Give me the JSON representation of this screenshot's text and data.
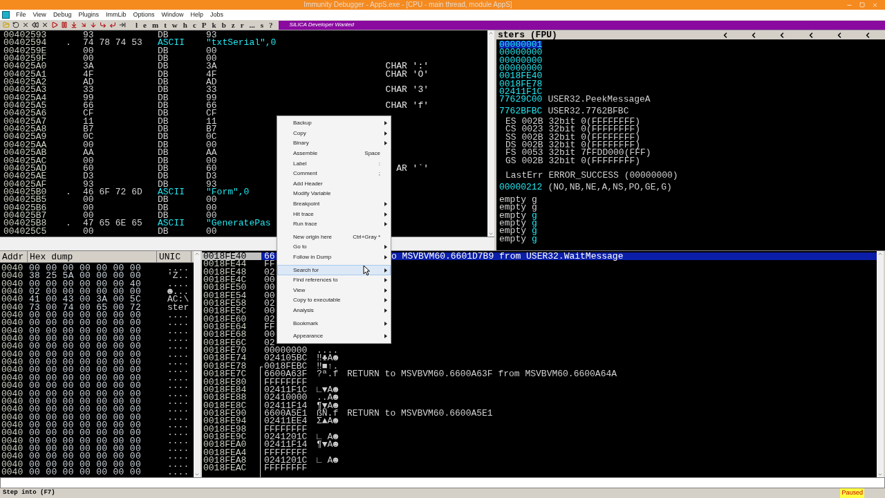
{
  "window": {
    "title": "Immunity Debugger - AppS.exe - [CPU - main thread, module AppS]"
  },
  "menu_bar": [
    "File",
    "View",
    "Debug",
    "Plugins",
    "ImmLib",
    "Options",
    "Window",
    "Help",
    "Jobs"
  ],
  "toolbar": {
    "letters": [
      "l",
      "e",
      "m",
      "t",
      "w",
      "h",
      "c",
      "P",
      "k",
      "b",
      "z",
      "r",
      "...",
      "s",
      "?"
    ],
    "banner": "SILICA Developer Wanted"
  },
  "disassembly": [
    {
      "kind": "db",
      "address": "00402593",
      "hex": "93",
      "mnemonic": "DB",
      "operand": "93"
    },
    {
      "kind": "ascii",
      "address": "00402594",
      "dot": ".",
      "hex": "74 78 74 53",
      "mnemonic": "ASCII",
      "operand": "\"txtSerial\",0"
    },
    {
      "kind": "db",
      "address": "0040259E",
      "hex": "00",
      "mnemonic": "DB",
      "operand": "00"
    },
    {
      "kind": "db",
      "address": "0040259F",
      "hex": "00",
      "mnemonic": "DB",
      "operand": "00"
    },
    {
      "kind": "db",
      "address": "004025A0",
      "hex": "3A",
      "mnemonic": "DB",
      "operand": "3A",
      "comment": "CHAR ':'"
    },
    {
      "kind": "db",
      "address": "004025A1",
      "hex": "4F",
      "mnemonic": "DB",
      "operand": "4F",
      "comment": "CHAR 'O'"
    },
    {
      "kind": "db",
      "address": "004025A2",
      "hex": "AD",
      "mnemonic": "DB",
      "operand": "AD"
    },
    {
      "kind": "db",
      "address": "004025A3",
      "hex": "33",
      "mnemonic": "DB",
      "operand": "33",
      "comment": "CHAR '3'"
    },
    {
      "kind": "db",
      "address": "004025A4",
      "hex": "99",
      "mnemonic": "DB",
      "operand": "99"
    },
    {
      "kind": "db",
      "address": "004025A5",
      "hex": "66",
      "mnemonic": "DB",
      "operand": "66",
      "comment": "CHAR 'f'"
    },
    {
      "kind": "db",
      "address": "004025A6",
      "hex": "CF",
      "mnemonic": "DB",
      "operand": "CF"
    },
    {
      "kind": "db",
      "address": "004025A7",
      "hex": "11",
      "mnemonic": "DB",
      "operand": "11"
    },
    {
      "kind": "db",
      "address": "004025A8",
      "hex": "B7",
      "mnemonic": "DB",
      "operand": "B7"
    },
    {
      "kind": "db",
      "address": "004025A9",
      "hex": "0C",
      "mnemonic": "DB",
      "operand": "0C"
    },
    {
      "kind": "db",
      "address": "004025AA",
      "hex": "00",
      "mnemonic": "DB",
      "operand": "00"
    },
    {
      "kind": "db",
      "address": "004025AB",
      "hex": "AA",
      "mnemonic": "DB",
      "operand": "AA"
    },
    {
      "kind": "db",
      "address": "004025AC",
      "hex": "00",
      "mnemonic": "DB",
      "operand": "00"
    },
    {
      "kind": "db",
      "address": "004025AD",
      "hex": "60",
      "mnemonic": "DB",
      "operand": "60",
      "comment": "AR '`'"
    },
    {
      "kind": "db",
      "address": "004025AE",
      "hex": "D3",
      "mnemonic": "DB",
      "operand": "D3"
    },
    {
      "kind": "db",
      "address": "004025AF",
      "hex": "93",
      "mnemonic": "DB",
      "operand": "93"
    },
    {
      "kind": "ascii",
      "address": "004025B0",
      "dot": ".",
      "hex": "46 6F 72 6D",
      "mnemonic": "ASCII",
      "operand": "\"Form\",0"
    },
    {
      "kind": "db",
      "address": "004025B5",
      "hex": "00",
      "mnemonic": "DB",
      "operand": "00"
    },
    {
      "kind": "db",
      "address": "004025B6",
      "hex": "00",
      "mnemonic": "DB",
      "operand": "00"
    },
    {
      "kind": "db",
      "address": "004025B7",
      "hex": "00",
      "mnemonic": "DB",
      "operand": "00"
    },
    {
      "kind": "ascii",
      "address": "004025B8",
      "dot": ".",
      "hex": "47 65 6E 65",
      "mnemonic": "ASCII",
      "operand": "\"GeneratePas"
    },
    {
      "kind": "db",
      "address": "004025C5",
      "hex": "00",
      "mnemonic": "DB",
      "operand": "00"
    }
  ],
  "registers": {
    "header": "sters (FPU)",
    "general": [
      {
        "value": "00000001",
        "selected": true
      },
      {
        "value": "00000000",
        "selected": false
      },
      {
        "value": "00000000",
        "selected": false
      },
      {
        "value": "00000000",
        "selected": false
      },
      {
        "value": "0018FE40",
        "selected": false
      },
      {
        "value": "0018FE78",
        "selected": false
      },
      {
        "value": "02411F1C",
        "selected": false
      },
      {
        "value": "77629C00",
        "comment": "USER32.PeekMessageA",
        "selected": false
      }
    ],
    "eip": {
      "value": "7762BFBC",
      "comment": "USER32.7762BFBC"
    },
    "segments": [
      "ES 002B 32bit 0(FFFFFFFF)",
      "CS 0023 32bit 0(FFFFFFFF)",
      "SS 002B 32bit 0(FFFFFFFF)",
      "DS 002B 32bit 0(FFFFFFFF)",
      "FS 0053 32bit 7FFDD000(FFF)",
      "GS 002B 32bit 0(FFFFFFFF)"
    ],
    "last_error": "LastErr ERROR_SUCCESS (00000000)",
    "flags": {
      "value": "00000212",
      "text": "(NO,NB,NE,A,NS,PO,GE,G)"
    },
    "fpu": [
      {
        "label": "empty",
        "tag": "g",
        "highlighted": false
      },
      {
        "label": "empty",
        "tag": "g",
        "highlighted": false
      },
      {
        "label": "empty",
        "tag": "g",
        "highlighted": true
      },
      {
        "label": "empty",
        "tag": "g",
        "highlighted": true
      },
      {
        "label": "empty",
        "tag": "g",
        "highlighted": true
      },
      {
        "label": "empty",
        "tag": "g",
        "highlighted": true
      }
    ]
  },
  "hex_dump": {
    "columns": [
      "Addr",
      "Hex dump",
      "UNIC"
    ],
    "rows": [
      {
        "address": "0040",
        "hex": "00 00 00 00 00 00 00",
        "text": "...."
      },
      {
        "address": "0040",
        "hex": "38 25 5A 00 00 00 00",
        "text": "'Z.."
      },
      {
        "address": "0040",
        "hex": "00 00 00 00 00 00 40",
        "text": "...."
      },
      {
        "address": "0040",
        "hex": "02 00 00 00 00 00 00",
        "text": "☻..."
      },
      {
        "address": "0040",
        "hex": "41 00 43 00 3A 00 5C",
        "text": "AC:\\"
      },
      {
        "address": "0040",
        "hex": "73 00 74 00 65 00 72",
        "text": "ster"
      },
      {
        "address": "0040",
        "hex": "00 00 00 00 00 00 00",
        "text": "...."
      },
      {
        "address": "0040",
        "hex": "00 00 00 00 00 00 00",
        "text": "...."
      },
      {
        "address": "0040",
        "hex": "00 00 00 00 00 00 00",
        "text": "...."
      },
      {
        "address": "0040",
        "hex": "00 00 00 00 00 00 00",
        "text": "...."
      },
      {
        "address": "0040",
        "hex": "00 00 00 00 00 00 00",
        "text": "...."
      },
      {
        "address": "0040",
        "hex": "00 00 00 00 00 00 00",
        "text": "...."
      },
      {
        "address": "0040",
        "hex": "00 00 00 00 00 00 00",
        "text": "...."
      },
      {
        "address": "0040",
        "hex": "00 00 00 00 00 00 00",
        "text": "...."
      },
      {
        "address": "0040",
        "hex": "00 00 00 00 00 00 00",
        "text": "...."
      },
      {
        "address": "0040",
        "hex": "00 00 00 00 00 00 00",
        "text": "...."
      },
      {
        "address": "0040",
        "hex": "00 00 00 00 00 00 00",
        "text": "...."
      },
      {
        "address": "0040",
        "hex": "00 00 00 00 00 00 00",
        "text": "...."
      },
      {
        "address": "0040",
        "hex": "00 00 00 00 00 00 00",
        "text": "...."
      },
      {
        "address": "0040",
        "hex": "00 00 00 00 00 00 00",
        "text": "...."
      },
      {
        "address": "0040",
        "hex": "00 00 00 00 00 00 00",
        "text": "...."
      },
      {
        "address": "0040",
        "hex": "00 00 00 00 00 00 00",
        "text": "...."
      },
      {
        "address": "0040",
        "hex": "00 00 00 00 00 00 00",
        "text": "...."
      },
      {
        "address": "0040",
        "hex": "00 00 00 00 00 00 00",
        "text": "...."
      },
      {
        "address": "0040",
        "hex": "00 00 00 00 00 00 00",
        "text": "...."
      },
      {
        "address": "0040",
        "hex": "00 00 00 00 00 00 00",
        "text": "...."
      },
      {
        "address": "0040",
        "hex": "00 00 00 00 00 00 00",
        "text": "...."
      }
    ]
  },
  "stack": [
    {
      "address": "0018FE40",
      "value": "66",
      "comment": "o MSVBVM60.6601D7B9 from USER32.WaitMessage",
      "selected": true
    },
    {
      "address": "0018FE44",
      "value": "FF",
      "selected": false
    },
    {
      "address": "0018FE48",
      "value": "02",
      "selected": false
    },
    {
      "address": "0018FE4C",
      "value": "00",
      "selected": false
    },
    {
      "address": "0018FE50",
      "value": "00",
      "selected": false
    },
    {
      "address": "0018FE54",
      "value": "00",
      "selected": false
    },
    {
      "address": "0018FE58",
      "value": "02",
      "selected": false
    },
    {
      "address": "0018FE5C",
      "value": "00",
      "selected": false
    },
    {
      "address": "0018FE60",
      "value": "02",
      "selected": false
    },
    {
      "address": "0018FE64",
      "value": "FF",
      "selected": false
    },
    {
      "address": "0018FE68",
      "value": "00",
      "selected": false
    },
    {
      "address": "0018FE6C",
      "value": "02",
      "selected": false
    },
    {
      "address": "0018FE70",
      "value": "00000000",
      "ascii": "....",
      "selected": false
    },
    {
      "address": "0018FE74",
      "value": "024105BC",
      "ascii": "‼♣A☻",
      "selected": false
    },
    {
      "address": "0018FE78",
      "value": "0018FEBC",
      "ascii": "‼■↑.",
      "selected": false
    },
    {
      "address": "0018FE7C",
      "value": "6600A63F",
      "ascii": "?ª.f",
      "comment": "RETURN to MSVBVM60.6600A63F from MSVBVM60.6600A64A",
      "selected": false
    },
    {
      "address": "0018FE80",
      "value": "FFFFFFFF",
      "selected": false
    },
    {
      "address": "0018FE84",
      "value": "02411F1C",
      "ascii": "∟▼A☻",
      "selected": false
    },
    {
      "address": "0018FE88",
      "value": "02410000",
      "ascii": "..A☻",
      "selected": false
    },
    {
      "address": "0018FE8C",
      "value": "02411F14",
      "ascii": "¶▼A☻",
      "selected": false
    },
    {
      "address": "0018FE90",
      "value": "6600A5E1",
      "ascii": "ßÑ.f",
      "comment": "RETURN to MSVBVM60.6600A5E1",
      "selected": false
    },
    {
      "address": "0018FE94",
      "value": "02411EE4",
      "ascii": "Σ▲A☻",
      "selected": false
    },
    {
      "address": "0018FE98",
      "value": "FFFFFFFF",
      "selected": false
    },
    {
      "address": "0018FE9C",
      "value": "0241201C",
      "ascii": "∟ A☻",
      "selected": false
    },
    {
      "address": "0018FEA0",
      "value": "02411F14",
      "ascii": "¶▼A☻",
      "selected": false
    },
    {
      "address": "0018FEA4",
      "value": "FFFFFFFF",
      "selected": false
    },
    {
      "address": "0018FEA8",
      "value": "0241201C",
      "ascii": "∟ A☻",
      "selected": false
    },
    {
      "address": "0018FEAC",
      "value": "FFFFFFFF",
      "selected": false
    }
  ],
  "context_menu": [
    {
      "kind": "item",
      "label": "Backup",
      "submenu": true,
      "selected": false
    },
    {
      "kind": "item",
      "label": "Copy",
      "submenu": true,
      "selected": false
    },
    {
      "kind": "item",
      "label": "Binary",
      "submenu": true,
      "selected": false
    },
    {
      "kind": "item",
      "label": "Assemble",
      "shortcut": "Space",
      "submenu": false,
      "selected": false
    },
    {
      "kind": "item",
      "label": "Label",
      "shortcut": ":",
      "submenu": false,
      "selected": false
    },
    {
      "kind": "item",
      "label": "Comment",
      "shortcut": ";",
      "submenu": false,
      "selected": false
    },
    {
      "kind": "item",
      "label": "Add Header",
      "submenu": false,
      "selected": false
    },
    {
      "kind": "item",
      "label": "Modify Variable",
      "submenu": false,
      "selected": false
    },
    {
      "kind": "item",
      "label": "Breakpoint",
      "submenu": true,
      "selected": false
    },
    {
      "kind": "item",
      "label": "Hit trace",
      "submenu": true,
      "selected": false
    },
    {
      "kind": "item",
      "label": "Run trace",
      "submenu": true,
      "selected": false
    },
    {
      "kind": "separator"
    },
    {
      "kind": "item",
      "label": "New origin here",
      "shortcut": "Ctrl+Gray *",
      "submenu": false,
      "selected": false
    },
    {
      "kind": "item",
      "label": "Go to",
      "submenu": true,
      "selected": false
    },
    {
      "kind": "item",
      "label": "Follow in Dump",
      "submenu": true,
      "selected": false
    },
    {
      "kind": "separator"
    },
    {
      "kind": "item",
      "label": "Search for",
      "submenu": true,
      "selected": true
    },
    {
      "kind": "item",
      "label": "Find references to",
      "submenu": true,
      "selected": false
    },
    {
      "kind": "item",
      "label": "View",
      "submenu": true,
      "selected": false
    },
    {
      "kind": "item",
      "label": "Copy to executable",
      "submenu": true,
      "selected": false
    },
    {
      "kind": "item",
      "label": "Analysis",
      "submenu": true,
      "selected": false
    },
    {
      "kind": "separator"
    },
    {
      "kind": "item",
      "label": "Bookmark",
      "submenu": true,
      "selected": false
    },
    {
      "kind": "separator"
    },
    {
      "kind": "item",
      "label": "Appearance",
      "submenu": true,
      "selected": false
    }
  ],
  "status_bar": {
    "message": "Step into (F7)",
    "state": "Paused"
  }
}
